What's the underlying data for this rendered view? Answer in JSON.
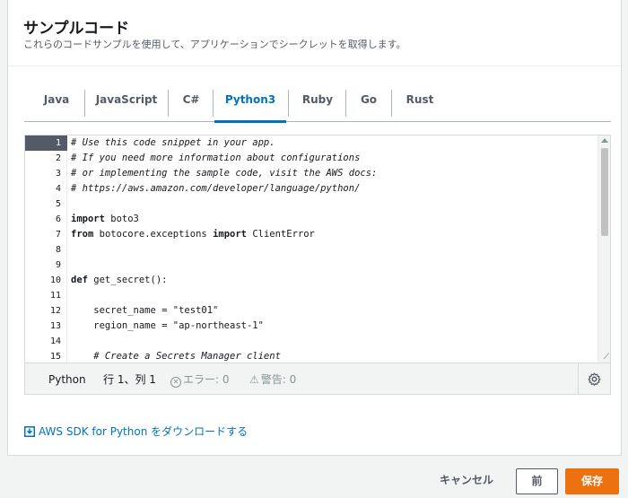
{
  "dialog": {
    "title": "サンプルコード",
    "subtitle": "これらのコードサンプルを使用して、アプリケーションでシークレットを取得します。"
  },
  "tabs": [
    {
      "label": "Java"
    },
    {
      "label": "JavaScript"
    },
    {
      "label": "C#"
    },
    {
      "label": "Python3",
      "active": true
    },
    {
      "label": "Ruby"
    },
    {
      "label": "Go"
    },
    {
      "label": "Rust"
    }
  ],
  "editor": {
    "line_numbers": [
      "1",
      "2",
      "3",
      "4",
      "5",
      "6",
      "7",
      "8",
      "9",
      "10",
      "11",
      "12",
      "13",
      "14",
      "15"
    ],
    "active_line": 1,
    "lines": [
      "# Use this code snippet in your app.",
      "# If you need more information about configurations",
      "# or implementing the sample code, visit the AWS docs:",
      "# https://aws.amazon.com/developer/language/python/",
      "",
      "import boto3",
      "from botocore.exceptions import ClientError",
      "",
      "",
      "def get_secret():",
      "",
      "    secret_name = \"test01\"",
      "    region_name = \"ap-northeast-1\"",
      "",
      "    # Create a Secrets Manager client"
    ],
    "status": {
      "language": "Python",
      "position": "行 1、列 1",
      "errors": "エラー: 0",
      "warnings": "警告: 0"
    },
    "settings_icon": "gear-icon"
  },
  "download_link": "AWS SDK for Python をダウンロードする",
  "footer": {
    "cancel": "キャンセル",
    "previous": "前",
    "save": "保存"
  },
  "colors": {
    "accent": "#0073bb",
    "primary_button": "#ec7211"
  }
}
